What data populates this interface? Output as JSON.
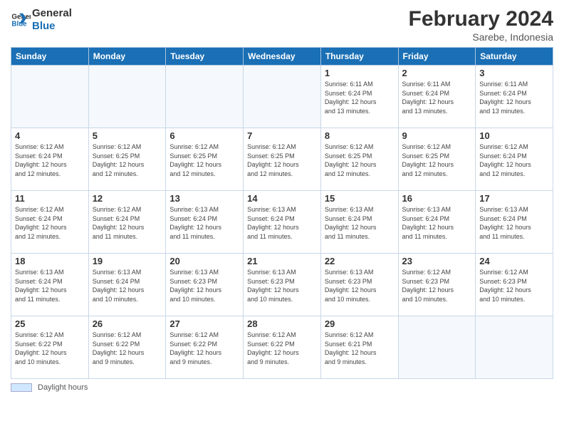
{
  "header": {
    "logo_general": "General",
    "logo_blue": "Blue",
    "month_title": "February 2024",
    "subtitle": "Sarebe, Indonesia"
  },
  "footer": {
    "legend_label": "Daylight hours"
  },
  "weekdays": [
    "Sunday",
    "Monday",
    "Tuesday",
    "Wednesday",
    "Thursday",
    "Friday",
    "Saturday"
  ],
  "weeks": [
    [
      {
        "day": "",
        "info": ""
      },
      {
        "day": "",
        "info": ""
      },
      {
        "day": "",
        "info": ""
      },
      {
        "day": "",
        "info": ""
      },
      {
        "day": "1",
        "info": "Sunrise: 6:11 AM\nSunset: 6:24 PM\nDaylight: 12 hours\nand 13 minutes."
      },
      {
        "day": "2",
        "info": "Sunrise: 6:11 AM\nSunset: 6:24 PM\nDaylight: 12 hours\nand 13 minutes."
      },
      {
        "day": "3",
        "info": "Sunrise: 6:11 AM\nSunset: 6:24 PM\nDaylight: 12 hours\nand 13 minutes."
      }
    ],
    [
      {
        "day": "4",
        "info": "Sunrise: 6:12 AM\nSunset: 6:24 PM\nDaylight: 12 hours\nand 12 minutes."
      },
      {
        "day": "5",
        "info": "Sunrise: 6:12 AM\nSunset: 6:25 PM\nDaylight: 12 hours\nand 12 minutes."
      },
      {
        "day": "6",
        "info": "Sunrise: 6:12 AM\nSunset: 6:25 PM\nDaylight: 12 hours\nand 12 minutes."
      },
      {
        "day": "7",
        "info": "Sunrise: 6:12 AM\nSunset: 6:25 PM\nDaylight: 12 hours\nand 12 minutes."
      },
      {
        "day": "8",
        "info": "Sunrise: 6:12 AM\nSunset: 6:25 PM\nDaylight: 12 hours\nand 12 minutes."
      },
      {
        "day": "9",
        "info": "Sunrise: 6:12 AM\nSunset: 6:25 PM\nDaylight: 12 hours\nand 12 minutes."
      },
      {
        "day": "10",
        "info": "Sunrise: 6:12 AM\nSunset: 6:24 PM\nDaylight: 12 hours\nand 12 minutes."
      }
    ],
    [
      {
        "day": "11",
        "info": "Sunrise: 6:12 AM\nSunset: 6:24 PM\nDaylight: 12 hours\nand 12 minutes."
      },
      {
        "day": "12",
        "info": "Sunrise: 6:12 AM\nSunset: 6:24 PM\nDaylight: 12 hours\nand 11 minutes."
      },
      {
        "day": "13",
        "info": "Sunrise: 6:13 AM\nSunset: 6:24 PM\nDaylight: 12 hours\nand 11 minutes."
      },
      {
        "day": "14",
        "info": "Sunrise: 6:13 AM\nSunset: 6:24 PM\nDaylight: 12 hours\nand 11 minutes."
      },
      {
        "day": "15",
        "info": "Sunrise: 6:13 AM\nSunset: 6:24 PM\nDaylight: 12 hours\nand 11 minutes."
      },
      {
        "day": "16",
        "info": "Sunrise: 6:13 AM\nSunset: 6:24 PM\nDaylight: 12 hours\nand 11 minutes."
      },
      {
        "day": "17",
        "info": "Sunrise: 6:13 AM\nSunset: 6:24 PM\nDaylight: 12 hours\nand 11 minutes."
      }
    ],
    [
      {
        "day": "18",
        "info": "Sunrise: 6:13 AM\nSunset: 6:24 PM\nDaylight: 12 hours\nand 11 minutes."
      },
      {
        "day": "19",
        "info": "Sunrise: 6:13 AM\nSunset: 6:24 PM\nDaylight: 12 hours\nand 10 minutes."
      },
      {
        "day": "20",
        "info": "Sunrise: 6:13 AM\nSunset: 6:23 PM\nDaylight: 12 hours\nand 10 minutes."
      },
      {
        "day": "21",
        "info": "Sunrise: 6:13 AM\nSunset: 6:23 PM\nDaylight: 12 hours\nand 10 minutes."
      },
      {
        "day": "22",
        "info": "Sunrise: 6:13 AM\nSunset: 6:23 PM\nDaylight: 12 hours\nand 10 minutes."
      },
      {
        "day": "23",
        "info": "Sunrise: 6:12 AM\nSunset: 6:23 PM\nDaylight: 12 hours\nand 10 minutes."
      },
      {
        "day": "24",
        "info": "Sunrise: 6:12 AM\nSunset: 6:23 PM\nDaylight: 12 hours\nand 10 minutes."
      }
    ],
    [
      {
        "day": "25",
        "info": "Sunrise: 6:12 AM\nSunset: 6:22 PM\nDaylight: 12 hours\nand 10 minutes."
      },
      {
        "day": "26",
        "info": "Sunrise: 6:12 AM\nSunset: 6:22 PM\nDaylight: 12 hours\nand 9 minutes."
      },
      {
        "day": "27",
        "info": "Sunrise: 6:12 AM\nSunset: 6:22 PM\nDaylight: 12 hours\nand 9 minutes."
      },
      {
        "day": "28",
        "info": "Sunrise: 6:12 AM\nSunset: 6:22 PM\nDaylight: 12 hours\nand 9 minutes."
      },
      {
        "day": "29",
        "info": "Sunrise: 6:12 AM\nSunset: 6:21 PM\nDaylight: 12 hours\nand 9 minutes."
      },
      {
        "day": "",
        "info": ""
      },
      {
        "day": "",
        "info": ""
      }
    ]
  ]
}
